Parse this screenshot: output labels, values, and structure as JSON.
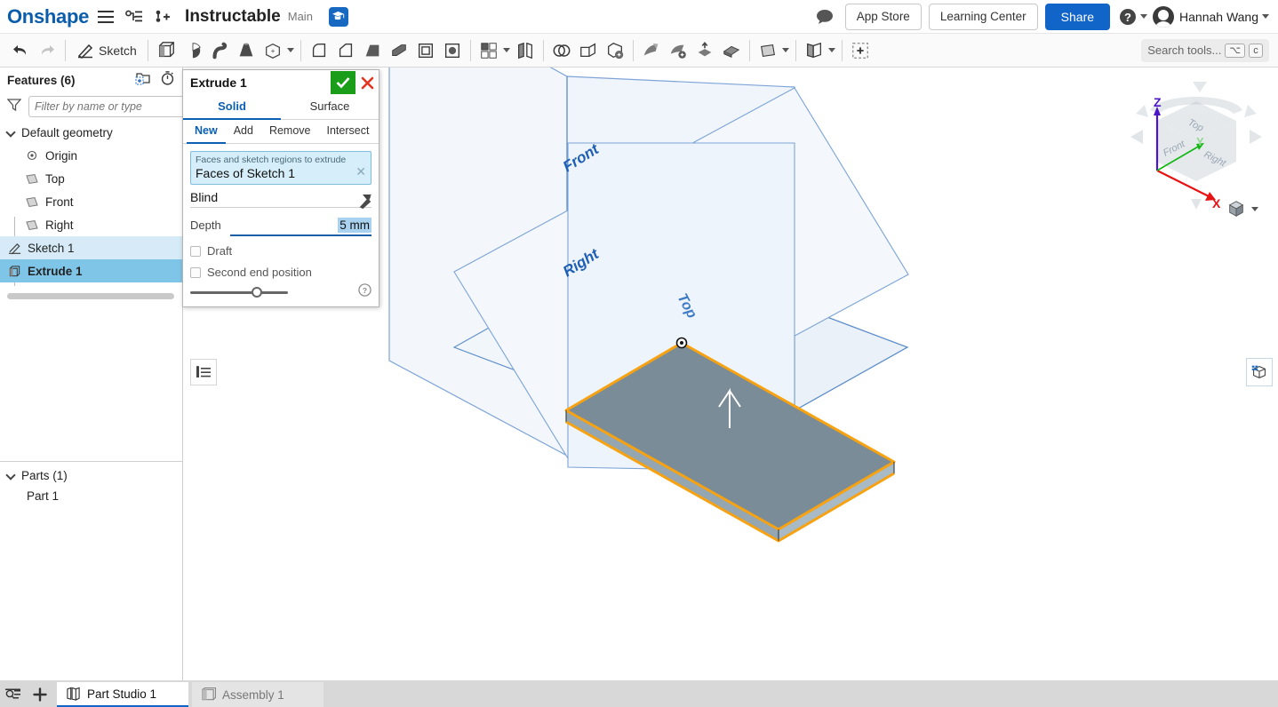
{
  "header": {
    "logo": "Onshape",
    "menu_icon": "hamburger-menu-icon",
    "tree_icon": "document-tree-icon",
    "versions_icon": "add-version-icon",
    "document_title": "Instructable",
    "branch": "Main",
    "learning_badge_icon": "graduation-cap-icon",
    "comment_icon": "comment-icon",
    "app_store_label": "App Store",
    "learning_center_label": "Learning Center",
    "share_label": "Share",
    "help_icon": "question-mark-icon",
    "user_name": "Hannah Wang"
  },
  "toolbar": {
    "undo_icon": "undo-arrow-icon",
    "redo_icon": "redo-arrow-icon",
    "sketch_label": "Sketch",
    "sketch_icon": "sketch-pencil-icon",
    "tools": [
      {
        "name": "extrude-tool",
        "icon": "extrude-icon"
      },
      {
        "name": "revolve-tool",
        "icon": "revolve-icon"
      },
      {
        "name": "sweep-tool",
        "icon": "sweep-icon"
      },
      {
        "name": "loft-tool",
        "icon": "loft-icon"
      },
      {
        "name": "more-features-tool",
        "icon": "more-features-icon"
      },
      {
        "name": "fillet-tool",
        "icon": "fillet-icon"
      },
      {
        "name": "chamfer-tool",
        "icon": "chamfer-icon"
      },
      {
        "name": "draft-tool",
        "icon": "draft-icon"
      },
      {
        "name": "rib-tool",
        "icon": "rib-icon"
      },
      {
        "name": "shell-tool",
        "icon": "shell-icon"
      },
      {
        "name": "hole-tool",
        "icon": "hole-icon"
      },
      {
        "name": "pattern-tool",
        "icon": "pattern-grid-icon"
      },
      {
        "name": "mirror-tool",
        "icon": "mirror-icon"
      },
      {
        "name": "boolean-tool",
        "icon": "boolean-circles-icon"
      },
      {
        "name": "split-tool",
        "icon": "split-icon"
      },
      {
        "name": "transform-tool",
        "icon": "transform-icon"
      },
      {
        "name": "delete-face-tool",
        "icon": "delete-face-icon"
      },
      {
        "name": "move-face-tool",
        "icon": "move-face-icon"
      },
      {
        "name": "delete-part-tool",
        "icon": "delete-part-icon"
      },
      {
        "name": "import-tool",
        "icon": "import-derive-icon"
      },
      {
        "name": "thicken-tool",
        "icon": "thicken-icon"
      },
      {
        "name": "plane-tool",
        "icon": "plane-icon"
      },
      {
        "name": "sheet-metal-tool",
        "icon": "sheet-metal-icon"
      },
      {
        "name": "insert-feature-tool",
        "icon": "plus-dashed-icon"
      }
    ],
    "search_placeholder": "Search tools...",
    "search_key_alt": "⌥",
    "search_key_c": "c"
  },
  "features_panel": {
    "title": "Features (6)",
    "add_folder_icon": "add-folder-icon",
    "rollback_icon": "stopwatch-icon",
    "filter_icon": "funnel-filter-icon",
    "filter_placeholder": "Filter by name or type",
    "tree": [
      {
        "label": "Default geometry",
        "icon": "chevron-down-icon",
        "level": 0,
        "state": "none"
      },
      {
        "label": "Origin",
        "icon": "origin-point-icon",
        "level": 1,
        "state": "none"
      },
      {
        "label": "Top",
        "icon": "plane-icon",
        "level": 1,
        "state": "none"
      },
      {
        "label": "Front",
        "icon": "plane-icon",
        "level": 1,
        "state": "none"
      },
      {
        "label": "Right",
        "icon": "plane-icon",
        "level": 1,
        "state": "none"
      },
      {
        "label": "Sketch 1",
        "icon": "sketch-pencil-icon",
        "level": 0,
        "state": "sel-light"
      },
      {
        "label": "Extrude 1",
        "icon": "extrude-icon",
        "level": 0,
        "state": "sel-strong"
      }
    ],
    "parts_title": "Parts (1)",
    "parts": [
      {
        "label": "Part 1",
        "icon": "part-cube-icon"
      }
    ]
  },
  "extrude_dialog": {
    "title": "Extrude 1",
    "accept_icon": "checkmark-icon",
    "cancel_icon": "close-x-icon",
    "type_tabs": [
      {
        "label": "Solid",
        "active": true
      },
      {
        "label": "Surface",
        "active": false
      }
    ],
    "operation_tabs": [
      {
        "label": "New",
        "active": true
      },
      {
        "label": "Add",
        "active": false
      },
      {
        "label": "Remove",
        "active": false
      },
      {
        "label": "Intersect",
        "active": false
      }
    ],
    "faces_field_label": "Faces and sketch regions to extrude",
    "faces_field_value": "Faces of Sketch 1",
    "faces_clear_icon": "clear-x-icon",
    "end_type": "Blind",
    "end_type_caret_icon": "chevron-down-icon",
    "flip_icon": "flip-direction-icon",
    "depth_label": "Depth",
    "depth_value": "5 mm",
    "draft_label": "Draft",
    "draft_checked": false,
    "second_end_label": "Second end position",
    "second_end_checked": false,
    "help_icon": "help-circle-icon",
    "opacity_slider_value": 62
  },
  "viewport": {
    "feature_list_icon": "feature-list-icon",
    "display_states_icon": "display-states-cube-icon",
    "view_mode_icon": "shaded-cube-icon",
    "view_mode_caret_icon": "chevron-down-icon",
    "planes": [
      {
        "label": "Front",
        "color": "#1e5fb5"
      },
      {
        "label": "Top",
        "color": "#1e5fb5"
      },
      {
        "label": "Right",
        "color": "#1e5fb5"
      }
    ],
    "direction_arrow_icon": "extrude-direction-arrow-icon",
    "origin_marker_icon": "origin-point-icon",
    "part_face_color": "#7b8c99",
    "highlight_edge_color": "#f7a210",
    "plane_edge_color": "#5c8ec9",
    "plane_fill_color": "#eaf1f9"
  },
  "viewcube": {
    "axis_z_label": "Z",
    "axis_y_label": "Y",
    "axis_x_label": "X",
    "face_top_label": "Top",
    "face_front_label": "Front",
    "face_right_label": "Right",
    "axis_z_color": "#4b14c8",
    "axis_y_color": "#12b812",
    "axis_x_color": "#e81414"
  },
  "bottom_bar": {
    "search_tabs_icon": "search-tabs-icon",
    "add_tab_icon": "plus-icon",
    "tabs": [
      {
        "label": "Part Studio 1",
        "icon": "part-studio-icon",
        "active": true
      },
      {
        "label": "Assembly 1",
        "icon": "assembly-icon",
        "active": false
      }
    ]
  }
}
